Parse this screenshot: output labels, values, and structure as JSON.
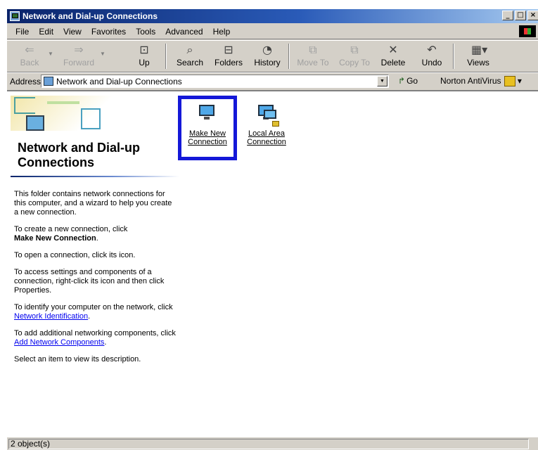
{
  "window": {
    "title": "Network and Dial-up Connections"
  },
  "menu": [
    "File",
    "Edit",
    "View",
    "Favorites",
    "Tools",
    "Advanced",
    "Help"
  ],
  "toolbar": {
    "back": "Back",
    "forward": "Forward",
    "up": "Up",
    "search": "Search",
    "folders": "Folders",
    "history": "History",
    "move_to": "Move To",
    "copy_to": "Copy To",
    "delete": "Delete",
    "undo": "Undo",
    "views": "Views"
  },
  "address": {
    "label": "Address",
    "value": "Network and Dial-up Connections",
    "go": "Go",
    "norton": "Norton AntiVirus"
  },
  "leftpanel": {
    "title": "Network and Dial-up Connections",
    "p1": "This folder contains network connections for this computer, and a wizard to help you create a new connection.",
    "p2_prefix": "To create a new connection, click",
    "p2_bold": "Make New Connection",
    "p3": "To open a connection, click its icon.",
    "p4": "To access settings and components of a connection, right-click its icon and then click Properties.",
    "p5_prefix": "To identify your computer on the network, click",
    "p5_link": "Network Identification",
    "p6_prefix": "To add additional networking components, click",
    "p6_link": "Add Network Components",
    "p7": "Select an item to view its description."
  },
  "icons": [
    {
      "label": "Make New Connection",
      "selected": true
    },
    {
      "label": "Local Area Connection",
      "selected": false
    }
  ],
  "status": {
    "text": "2 object(s)"
  }
}
